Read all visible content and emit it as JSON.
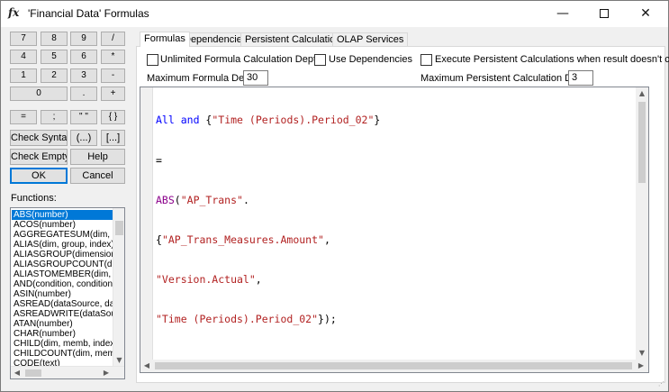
{
  "window": {
    "title": "'Financial Data' Formulas",
    "icon": "fx",
    "minimize": "—",
    "close": "✕"
  },
  "keypad": {
    "row1": [
      "7",
      "8",
      "9",
      "/"
    ],
    "row2": [
      "4",
      "5",
      "6",
      "*"
    ],
    "row3": [
      "1",
      "2",
      "3",
      "-"
    ],
    "row4": [
      "0",
      ".",
      "+"
    ],
    "row5": [
      "=",
      ";",
      "\" \"",
      "{ }"
    ],
    "check_syntax": "Check Syntax",
    "paren": "(...)",
    "bracket": "[...]",
    "check_empty": "Check Empty",
    "help": "Help",
    "ok": "OK",
    "cancel": "Cancel"
  },
  "functions": {
    "label": "Functions:",
    "items": [
      "ABS(number)",
      "ACOS(number)",
      "AGGREGATESUM(dim, me",
      "ALIAS(dim, group, index)",
      "ALIASGROUP(dimension, i",
      "ALIASGROUPCOUNT(dime",
      "ALIASTOMEMBER(dim, gro",
      "AND(condition, condition, ...",
      "ASIN(number)",
      "ASREAD(dataSource, data",
      "ASREADWRITE(dataSourc",
      "ATAN(number)",
      "CHAR(number)",
      "CHILD(dim, memb, index)",
      "CHILDCOUNT(dim, memb)",
      "CODE(text)"
    ],
    "selected_index": 0
  },
  "tabs": [
    "Formulas",
    "Dependencies",
    "Persistent Calculations",
    "OLAP Services"
  ],
  "active_tab": "Formulas",
  "options": {
    "unlimited_depth": "Unlimited Formula Calculation Depth",
    "use_dependencies": "Use Dependencies",
    "execute_persistent": "Execute Persistent Calculations when result doesn't change",
    "max_formula_depth_label": "Maximum Formula Depth:",
    "max_formula_depth_value": "30",
    "max_persistent_depth_label": "Maximum Persistent Calculation Depth:",
    "max_persistent_depth_value": "3"
  },
  "formula": {
    "line1": {
      "kw1": "All",
      "kw2": "and",
      "brace_open": " {",
      "str": "\"Time (Periods).Period_02\"",
      "brace_close": "}"
    },
    "line2": "=",
    "line3": {
      "fn": "ABS",
      "paren": "(",
      "str": "\"AP_Trans\"",
      "dot": "."
    },
    "line4": {
      "brace": "{",
      "str": "\"AP_Trans_Measures.Amount\"",
      "comma": ","
    },
    "line5": {
      "str": "\"Version.Actual\"",
      "comma": ","
    },
    "line6": {
      "str": "\"Time (Periods).Period_02\"",
      "end": "});"
    }
  },
  "colors": {
    "keyword": "#0000ff",
    "function": "#8b008b",
    "string": "#b22222",
    "selection": "#0078d7"
  }
}
